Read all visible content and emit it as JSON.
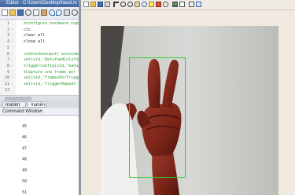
{
  "editor": {
    "title": "Editor - C:\\Users\\Desktop\\hand.m",
    "lines": [
      {
        "no": "1",
        "fold": "",
        "text": "%configure hardware input",
        "style": "comment"
      },
      {
        "no": "2",
        "fold": "-",
        "text": "clc",
        "style": "plain"
      },
      {
        "no": "3",
        "fold": "-",
        "text": "clear all",
        "style": "plain"
      },
      {
        "no": "4",
        "fold": "-",
        "text": "close all",
        "style": "plain"
      },
      {
        "no": "5",
        "fold": "",
        "text": "",
        "style": "plain"
      },
      {
        "no": "6",
        "fold": "-",
        "text": "vid=videoinput('winvideo',",
        "style": "comment"
      },
      {
        "no": "7",
        "fold": "-",
        "text": "set(vid,'ReturnedColorSpace'",
        "style": "comment"
      },
      {
        "no": "8",
        "fold": "-",
        "text": "triggerconfig(vid,'manual')",
        "style": "comment"
      },
      {
        "no": "9",
        "fold": "",
        "text": "%Capture one frame per trigger",
        "style": "comment"
      },
      {
        "no": "10",
        "fold": "-",
        "text": "set(vid,'FramesPerTrigger'",
        "style": "comment"
      },
      {
        "no": "11",
        "fold": "-",
        "text": "set(vid,'TriggerRepeat',",
        "style": "comment"
      },
      {
        "no": "12",
        "fold": "",
        "text": "",
        "style": "plain"
      }
    ],
    "tabs": [
      "mahim",
      "mahim"
    ]
  },
  "command_window": {
    "title": "Command Window",
    "lines": [
      "45",
      "46",
      "47",
      "48",
      "49",
      "50",
      "51"
    ]
  },
  "colors": {
    "bounding_box": "#2fd12f",
    "comment": "#2b9b2b"
  }
}
